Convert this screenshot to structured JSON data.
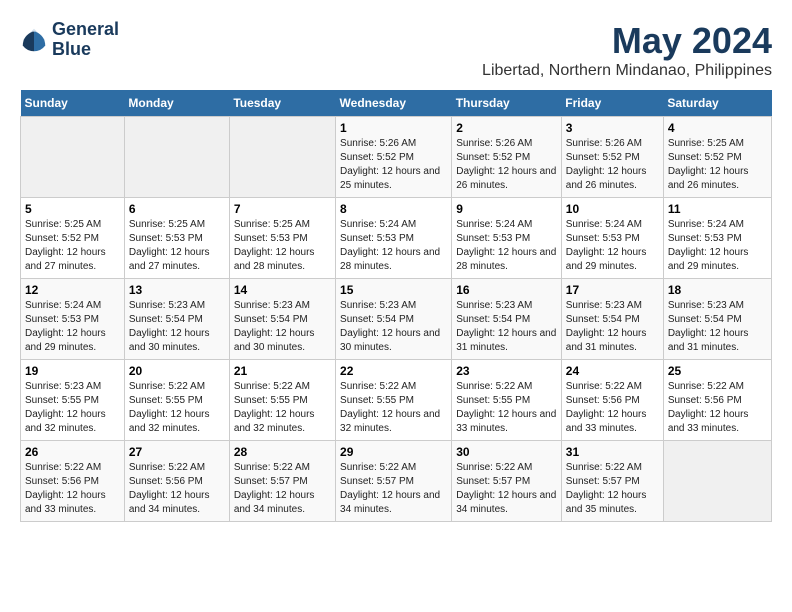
{
  "header": {
    "logo_line1": "General",
    "logo_line2": "Blue",
    "title": "May 2024",
    "subtitle": "Libertad, Northern Mindanao, Philippines"
  },
  "days_of_week": [
    "Sunday",
    "Monday",
    "Tuesday",
    "Wednesday",
    "Thursday",
    "Friday",
    "Saturday"
  ],
  "weeks": [
    [
      {
        "day": "",
        "sunrise": "",
        "sunset": "",
        "daylight": ""
      },
      {
        "day": "",
        "sunrise": "",
        "sunset": "",
        "daylight": ""
      },
      {
        "day": "",
        "sunrise": "",
        "sunset": "",
        "daylight": ""
      },
      {
        "day": "1",
        "sunrise": "Sunrise: 5:26 AM",
        "sunset": "Sunset: 5:52 PM",
        "daylight": "Daylight: 12 hours and 25 minutes."
      },
      {
        "day": "2",
        "sunrise": "Sunrise: 5:26 AM",
        "sunset": "Sunset: 5:52 PM",
        "daylight": "Daylight: 12 hours and 26 minutes."
      },
      {
        "day": "3",
        "sunrise": "Sunrise: 5:26 AM",
        "sunset": "Sunset: 5:52 PM",
        "daylight": "Daylight: 12 hours and 26 minutes."
      },
      {
        "day": "4",
        "sunrise": "Sunrise: 5:25 AM",
        "sunset": "Sunset: 5:52 PM",
        "daylight": "Daylight: 12 hours and 26 minutes."
      }
    ],
    [
      {
        "day": "5",
        "sunrise": "Sunrise: 5:25 AM",
        "sunset": "Sunset: 5:52 PM",
        "daylight": "Daylight: 12 hours and 27 minutes."
      },
      {
        "day": "6",
        "sunrise": "Sunrise: 5:25 AM",
        "sunset": "Sunset: 5:53 PM",
        "daylight": "Daylight: 12 hours and 27 minutes."
      },
      {
        "day": "7",
        "sunrise": "Sunrise: 5:25 AM",
        "sunset": "Sunset: 5:53 PM",
        "daylight": "Daylight: 12 hours and 28 minutes."
      },
      {
        "day": "8",
        "sunrise": "Sunrise: 5:24 AM",
        "sunset": "Sunset: 5:53 PM",
        "daylight": "Daylight: 12 hours and 28 minutes."
      },
      {
        "day": "9",
        "sunrise": "Sunrise: 5:24 AM",
        "sunset": "Sunset: 5:53 PM",
        "daylight": "Daylight: 12 hours and 28 minutes."
      },
      {
        "day": "10",
        "sunrise": "Sunrise: 5:24 AM",
        "sunset": "Sunset: 5:53 PM",
        "daylight": "Daylight: 12 hours and 29 minutes."
      },
      {
        "day": "11",
        "sunrise": "Sunrise: 5:24 AM",
        "sunset": "Sunset: 5:53 PM",
        "daylight": "Daylight: 12 hours and 29 minutes."
      }
    ],
    [
      {
        "day": "12",
        "sunrise": "Sunrise: 5:24 AM",
        "sunset": "Sunset: 5:53 PM",
        "daylight": "Daylight: 12 hours and 29 minutes."
      },
      {
        "day": "13",
        "sunrise": "Sunrise: 5:23 AM",
        "sunset": "Sunset: 5:54 PM",
        "daylight": "Daylight: 12 hours and 30 minutes."
      },
      {
        "day": "14",
        "sunrise": "Sunrise: 5:23 AM",
        "sunset": "Sunset: 5:54 PM",
        "daylight": "Daylight: 12 hours and 30 minutes."
      },
      {
        "day": "15",
        "sunrise": "Sunrise: 5:23 AM",
        "sunset": "Sunset: 5:54 PM",
        "daylight": "Daylight: 12 hours and 30 minutes."
      },
      {
        "day": "16",
        "sunrise": "Sunrise: 5:23 AM",
        "sunset": "Sunset: 5:54 PM",
        "daylight": "Daylight: 12 hours and 31 minutes."
      },
      {
        "day": "17",
        "sunrise": "Sunrise: 5:23 AM",
        "sunset": "Sunset: 5:54 PM",
        "daylight": "Daylight: 12 hours and 31 minutes."
      },
      {
        "day": "18",
        "sunrise": "Sunrise: 5:23 AM",
        "sunset": "Sunset: 5:54 PM",
        "daylight": "Daylight: 12 hours and 31 minutes."
      }
    ],
    [
      {
        "day": "19",
        "sunrise": "Sunrise: 5:23 AM",
        "sunset": "Sunset: 5:55 PM",
        "daylight": "Daylight: 12 hours and 32 minutes."
      },
      {
        "day": "20",
        "sunrise": "Sunrise: 5:22 AM",
        "sunset": "Sunset: 5:55 PM",
        "daylight": "Daylight: 12 hours and 32 minutes."
      },
      {
        "day": "21",
        "sunrise": "Sunrise: 5:22 AM",
        "sunset": "Sunset: 5:55 PM",
        "daylight": "Daylight: 12 hours and 32 minutes."
      },
      {
        "day": "22",
        "sunrise": "Sunrise: 5:22 AM",
        "sunset": "Sunset: 5:55 PM",
        "daylight": "Daylight: 12 hours and 32 minutes."
      },
      {
        "day": "23",
        "sunrise": "Sunrise: 5:22 AM",
        "sunset": "Sunset: 5:55 PM",
        "daylight": "Daylight: 12 hours and 33 minutes."
      },
      {
        "day": "24",
        "sunrise": "Sunrise: 5:22 AM",
        "sunset": "Sunset: 5:56 PM",
        "daylight": "Daylight: 12 hours and 33 minutes."
      },
      {
        "day": "25",
        "sunrise": "Sunrise: 5:22 AM",
        "sunset": "Sunset: 5:56 PM",
        "daylight": "Daylight: 12 hours and 33 minutes."
      }
    ],
    [
      {
        "day": "26",
        "sunrise": "Sunrise: 5:22 AM",
        "sunset": "Sunset: 5:56 PM",
        "daylight": "Daylight: 12 hours and 33 minutes."
      },
      {
        "day": "27",
        "sunrise": "Sunrise: 5:22 AM",
        "sunset": "Sunset: 5:56 PM",
        "daylight": "Daylight: 12 hours and 34 minutes."
      },
      {
        "day": "28",
        "sunrise": "Sunrise: 5:22 AM",
        "sunset": "Sunset: 5:57 PM",
        "daylight": "Daylight: 12 hours and 34 minutes."
      },
      {
        "day": "29",
        "sunrise": "Sunrise: 5:22 AM",
        "sunset": "Sunset: 5:57 PM",
        "daylight": "Daylight: 12 hours and 34 minutes."
      },
      {
        "day": "30",
        "sunrise": "Sunrise: 5:22 AM",
        "sunset": "Sunset: 5:57 PM",
        "daylight": "Daylight: 12 hours and 34 minutes."
      },
      {
        "day": "31",
        "sunrise": "Sunrise: 5:22 AM",
        "sunset": "Sunset: 5:57 PM",
        "daylight": "Daylight: 12 hours and 35 minutes."
      },
      {
        "day": "",
        "sunrise": "",
        "sunset": "",
        "daylight": ""
      }
    ]
  ]
}
